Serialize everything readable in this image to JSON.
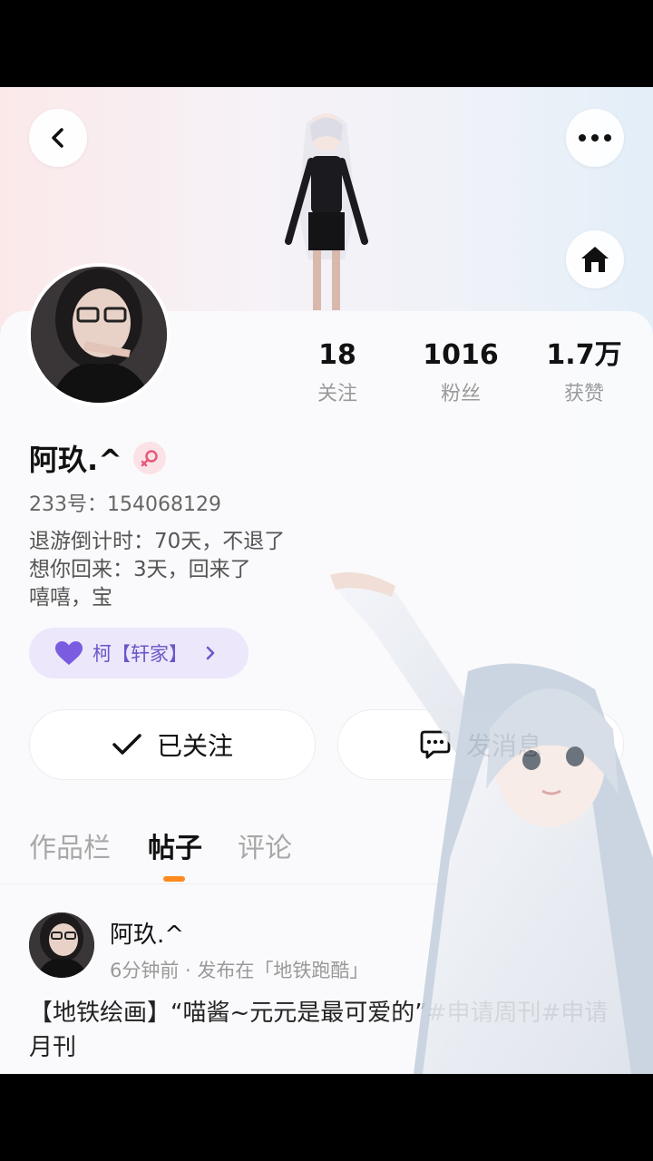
{
  "header": {
    "back_icon": "chevron-left-icon",
    "more_icon": "more-dots-icon",
    "home_icon": "home-icon"
  },
  "profile": {
    "name": "阿玖.^",
    "gender_icon": "female-icon",
    "uid": "233号：154068129",
    "bio_lines": [
      "退游倒计时：70天，不退了",
      "想你回来：3天，回来了",
      "嘻嘻，宝"
    ],
    "guild_label": "柯【轩家】"
  },
  "stats": [
    {
      "value": "18",
      "label": "关注"
    },
    {
      "value": "1016",
      "label": "粉丝"
    },
    {
      "value": "1.7万",
      "label": "获赞"
    }
  ],
  "actions": {
    "follow_label": "已关注",
    "message_label": "发消息"
  },
  "tabs": [
    {
      "label": "作品栏"
    },
    {
      "label": "帖子"
    },
    {
      "label": "评论"
    }
  ],
  "post": {
    "author": "阿玖.^",
    "meta": "6分钟前 · 发布在「地铁跑酷」",
    "text": "【地铁绘画】“喵酱~元元是最可爱的”#申请周刊#申请月刊"
  },
  "colors": {
    "accent": "#ff8a1f",
    "guild": "#6d55c9",
    "guild_bg": "#ece7fb"
  }
}
